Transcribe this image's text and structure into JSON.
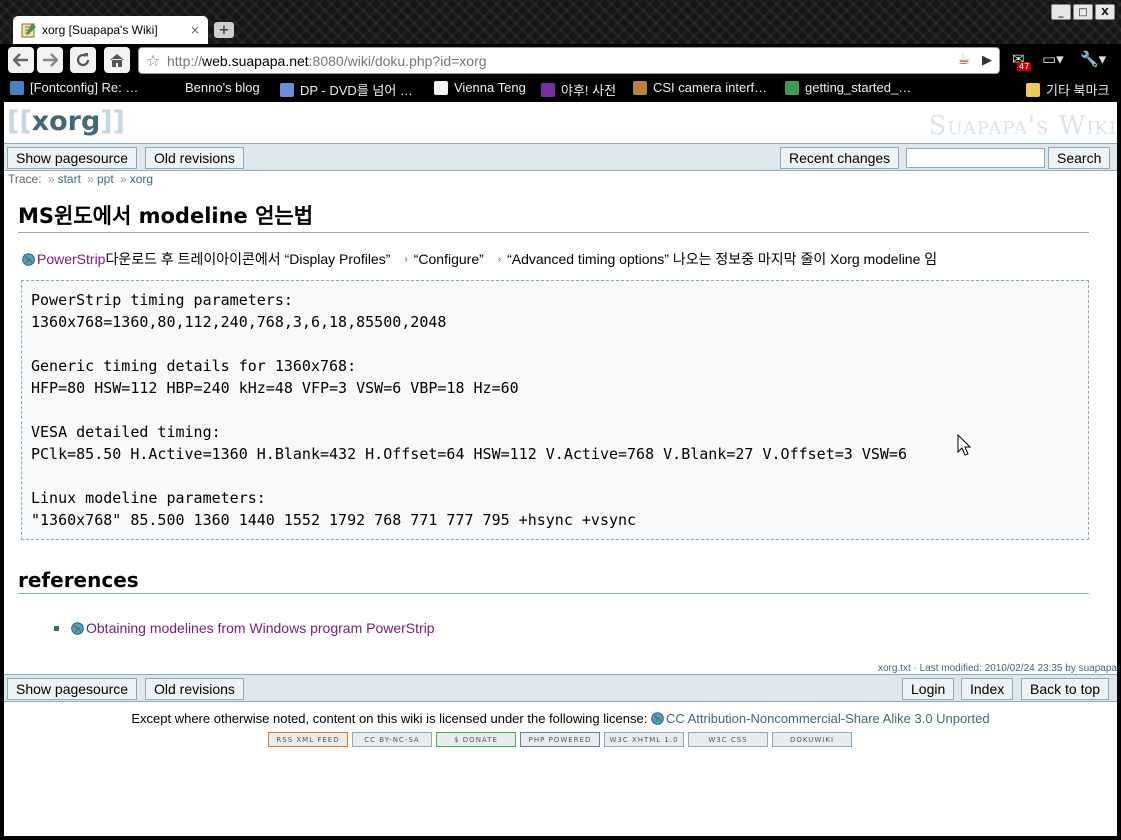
{
  "browser": {
    "tab_title": "xorg [Suapapa's Wiki]",
    "tab_close": "×",
    "new_tab": "+",
    "window_buttons": [
      "_",
      "□",
      "X"
    ],
    "url_prefix": "http://",
    "url_host": "web.suapapa.net",
    "url_rest": ":8080/wiki/doku.php?id=xorg",
    "notification_count": "47",
    "bookmarks": [
      "[Fontconfig] Re: …",
      "Benno's blog",
      "DP - DVD를 넘어 …",
      "Vienna Teng",
      "야후! 사전",
      "CSI camera interf…",
      "getting_started_…",
      "기타 북마크"
    ]
  },
  "wiki": {
    "title_open": "[[",
    "title": "xorg",
    "title_close": "]]",
    "site_name": "Suapapa's Wiki",
    "top_buttons": {
      "pagesource": "Show pagesource",
      "revisions": "Old revisions",
      "recent": "Recent changes",
      "search": "Search"
    },
    "search_value": "",
    "breadcrumbs": {
      "label": "Trace:",
      "sep": "»",
      "items": [
        "start",
        "ppt",
        "xorg"
      ]
    },
    "heading1": "MS윈도에서 modeline 얻는법",
    "intro": {
      "link": "PowerStrip",
      "text1": "다운로드 후 트레이아이콘에서 “Display Profiles”",
      "text2": "“Configure”",
      "text3": "“Advanced timing options” 나오는 정보중 마지막 줄이 Xorg modeline 임",
      "arrow": "›"
    },
    "code": "PowerStrip timing parameters:\n1360x768=1360,80,112,240,768,3,6,18,85500,2048\n\nGeneric timing details for 1360x768:\nHFP=80 HSW=112 HBP=240 kHz=48 VFP=3 VSW=6 VBP=18 Hz=60\n\nVESA detailed timing:\nPClk=85.50 H.Active=1360 H.Blank=432 H.Offset=64 HSW=112 V.Active=768 V.Blank=27 V.Offset=3 VSW=6\n\nLinux modeline parameters:\n\"1360x768\" 85.500 1360 1440 1552 1792 768 771 777 795 +hsync +vsync",
    "heading2": "references",
    "references": [
      "Obtaining modelines from Windows program PowerStrip"
    ],
    "docinfo": "xorg.txt · Last modified: 2010/02/24 23:35 by suapapa",
    "bottom_buttons": {
      "pagesource": "Show pagesource",
      "revisions": "Old revisions",
      "login": "Login",
      "index": "Index",
      "top": "Back to top"
    },
    "license_text": "Except where otherwise noted, content on this wiki is licensed under the following license:",
    "license_link": "CC Attribution-Noncommercial-Share Alike 3.0 Unported",
    "badges": [
      "RSS XML FEED",
      "CC BY-NC-SA",
      "$ DONATE",
      "PHP POWERED",
      "W3C XHTML 1.0",
      "W3C CSS",
      "DOKUWIKI"
    ]
  }
}
